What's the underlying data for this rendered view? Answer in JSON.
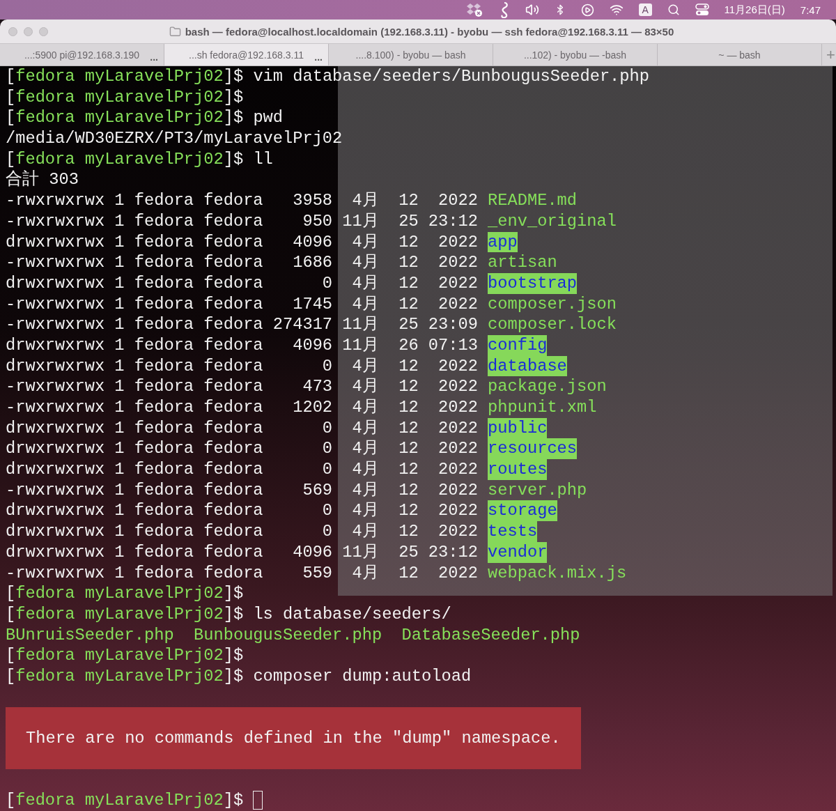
{
  "menu_bar": {
    "input_source": "A",
    "date": "11月26日(日)",
    "time": "7:47"
  },
  "window": {
    "title": "bash — fedora@localhost.localdomain (192.168.3.11) - byobu — ssh fedora@192.168.3.11 — 83×50"
  },
  "tabs": [
    {
      "label": "...:5900 pi@192.168.3.190",
      "more": "...",
      "selected": false
    },
    {
      "label": "...sh fedora@192.168.3.11",
      "more": "...",
      "selected": true
    },
    {
      "label": "....8.100) - byobu — bash",
      "selected": false
    },
    {
      "label": "...102) - byobu — -bash",
      "selected": false
    },
    {
      "label": "~ — bash",
      "selected": false
    }
  ],
  "new_tab": "+",
  "terminal": {
    "lines": [
      {
        "kind": "prompt",
        "prefix": "[",
        "context": "fedora myLaravelPrj02",
        "suffix": "]$",
        "command": "vim database/seeders/BunbougusSeeder.php"
      },
      {
        "kind": "prompt",
        "prefix": "[",
        "context": "fedora myLaravelPrj02",
        "suffix": "]$"
      },
      {
        "kind": "prompt",
        "prefix": "[",
        "context": "fedora myLaravelPrj02",
        "suffix": "]$",
        "command": "pwd"
      },
      {
        "kind": "output",
        "text": "/media/WD30EZRX/PT3/myLaravelPrj02"
      },
      {
        "kind": "prompt",
        "prefix": "[",
        "context": "fedora myLaravelPrj02",
        "suffix": "]$",
        "command": "ll"
      },
      {
        "kind": "output",
        "text": "合計 303"
      },
      {
        "kind": "listing",
        "info": "-rwxrwxrwx 1 fedora fedora   3958  4月  12  2022",
        "name": "README.md",
        "directory": false
      },
      {
        "kind": "listing",
        "info": "-rwxrwxrwx 1 fedora fedora    950 11月  25 23:12",
        "name": "_env_original",
        "directory": false
      },
      {
        "kind": "listing",
        "info": "drwxrwxrwx 1 fedora fedora   4096  4月  12  2022",
        "name": "app",
        "directory": true
      },
      {
        "kind": "listing",
        "info": "-rwxrwxrwx 1 fedora fedora   1686  4月  12  2022",
        "name": "artisan",
        "directory": false
      },
      {
        "kind": "listing",
        "info": "drwxrwxrwx 1 fedora fedora      0  4月  12  2022",
        "name": "bootstrap",
        "directory": true
      },
      {
        "kind": "listing",
        "info": "-rwxrwxrwx 1 fedora fedora   1745  4月  12  2022",
        "name": "composer.json",
        "directory": false
      },
      {
        "kind": "listing",
        "info": "-rwxrwxrwx 1 fedora fedora 274317 11月  25 23:09",
        "name": "composer.lock",
        "directory": false
      },
      {
        "kind": "listing",
        "info": "drwxrwxrwx 1 fedora fedora   4096 11月  26 07:13",
        "name": "config",
        "directory": true
      },
      {
        "kind": "listing",
        "info": "drwxrwxrwx 1 fedora fedora      0  4月  12  2022",
        "name": "database",
        "directory": true
      },
      {
        "kind": "listing",
        "info": "-rwxrwxrwx 1 fedora fedora    473  4月  12  2022",
        "name": "package.json",
        "directory": false
      },
      {
        "kind": "listing",
        "info": "-rwxrwxrwx 1 fedora fedora   1202  4月  12  2022",
        "name": "phpunit.xml",
        "directory": false
      },
      {
        "kind": "listing",
        "info": "drwxrwxrwx 1 fedora fedora      0  4月  12  2022",
        "name": "public",
        "directory": true
      },
      {
        "kind": "listing",
        "info": "drwxrwxrwx 1 fedora fedora      0  4月  12  2022",
        "name": "resources",
        "directory": true
      },
      {
        "kind": "listing",
        "info": "drwxrwxrwx 1 fedora fedora      0  4月  12  2022",
        "name": "routes",
        "directory": true
      },
      {
        "kind": "listing",
        "info": "-rwxrwxrwx 1 fedora fedora    569  4月  12  2022",
        "name": "server.php",
        "directory": false
      },
      {
        "kind": "listing",
        "info": "drwxrwxrwx 1 fedora fedora      0  4月  12  2022",
        "name": "storage",
        "directory": true
      },
      {
        "kind": "listing",
        "info": "drwxrwxrwx 1 fedora fedora      0  4月  12  2022",
        "name": "tests",
        "directory": true
      },
      {
        "kind": "listing",
        "info": "drwxrwxrwx 1 fedora fedora   4096 11月  25 23:12",
        "name": "vendor",
        "directory": true
      },
      {
        "kind": "listing",
        "info": "-rwxrwxrwx 1 fedora fedora    559  4月  12  2022",
        "name": "webpack.mix.js",
        "directory": false
      },
      {
        "kind": "prompt",
        "prefix": "[",
        "context": "fedora myLaravelPrj02",
        "suffix": "]$"
      },
      {
        "kind": "prompt",
        "prefix": "[",
        "context": "fedora myLaravelPrj02",
        "suffix": "]$",
        "command": "ls database/seeders/"
      },
      {
        "kind": "files",
        "names": [
          "BUnruisSeeder.php",
          "BunbougusSeeder.php",
          "DatabaseSeeder.php"
        ]
      },
      {
        "kind": "prompt",
        "prefix": "[",
        "context": "fedora myLaravelPrj02",
        "suffix": "]$"
      },
      {
        "kind": "prompt",
        "prefix": "[",
        "context": "fedora myLaravelPrj02",
        "suffix": "]$",
        "command": "composer dump:autoload"
      },
      {
        "kind": "blank"
      },
      {
        "kind": "error",
        "text": "There are no commands defined in the \"dump\" namespace."
      },
      {
        "kind": "blank"
      },
      {
        "kind": "prompt",
        "prefix": "[",
        "context": "fedora myLaravelPrj02",
        "suffix": "]$",
        "cursor": true
      }
    ]
  }
}
